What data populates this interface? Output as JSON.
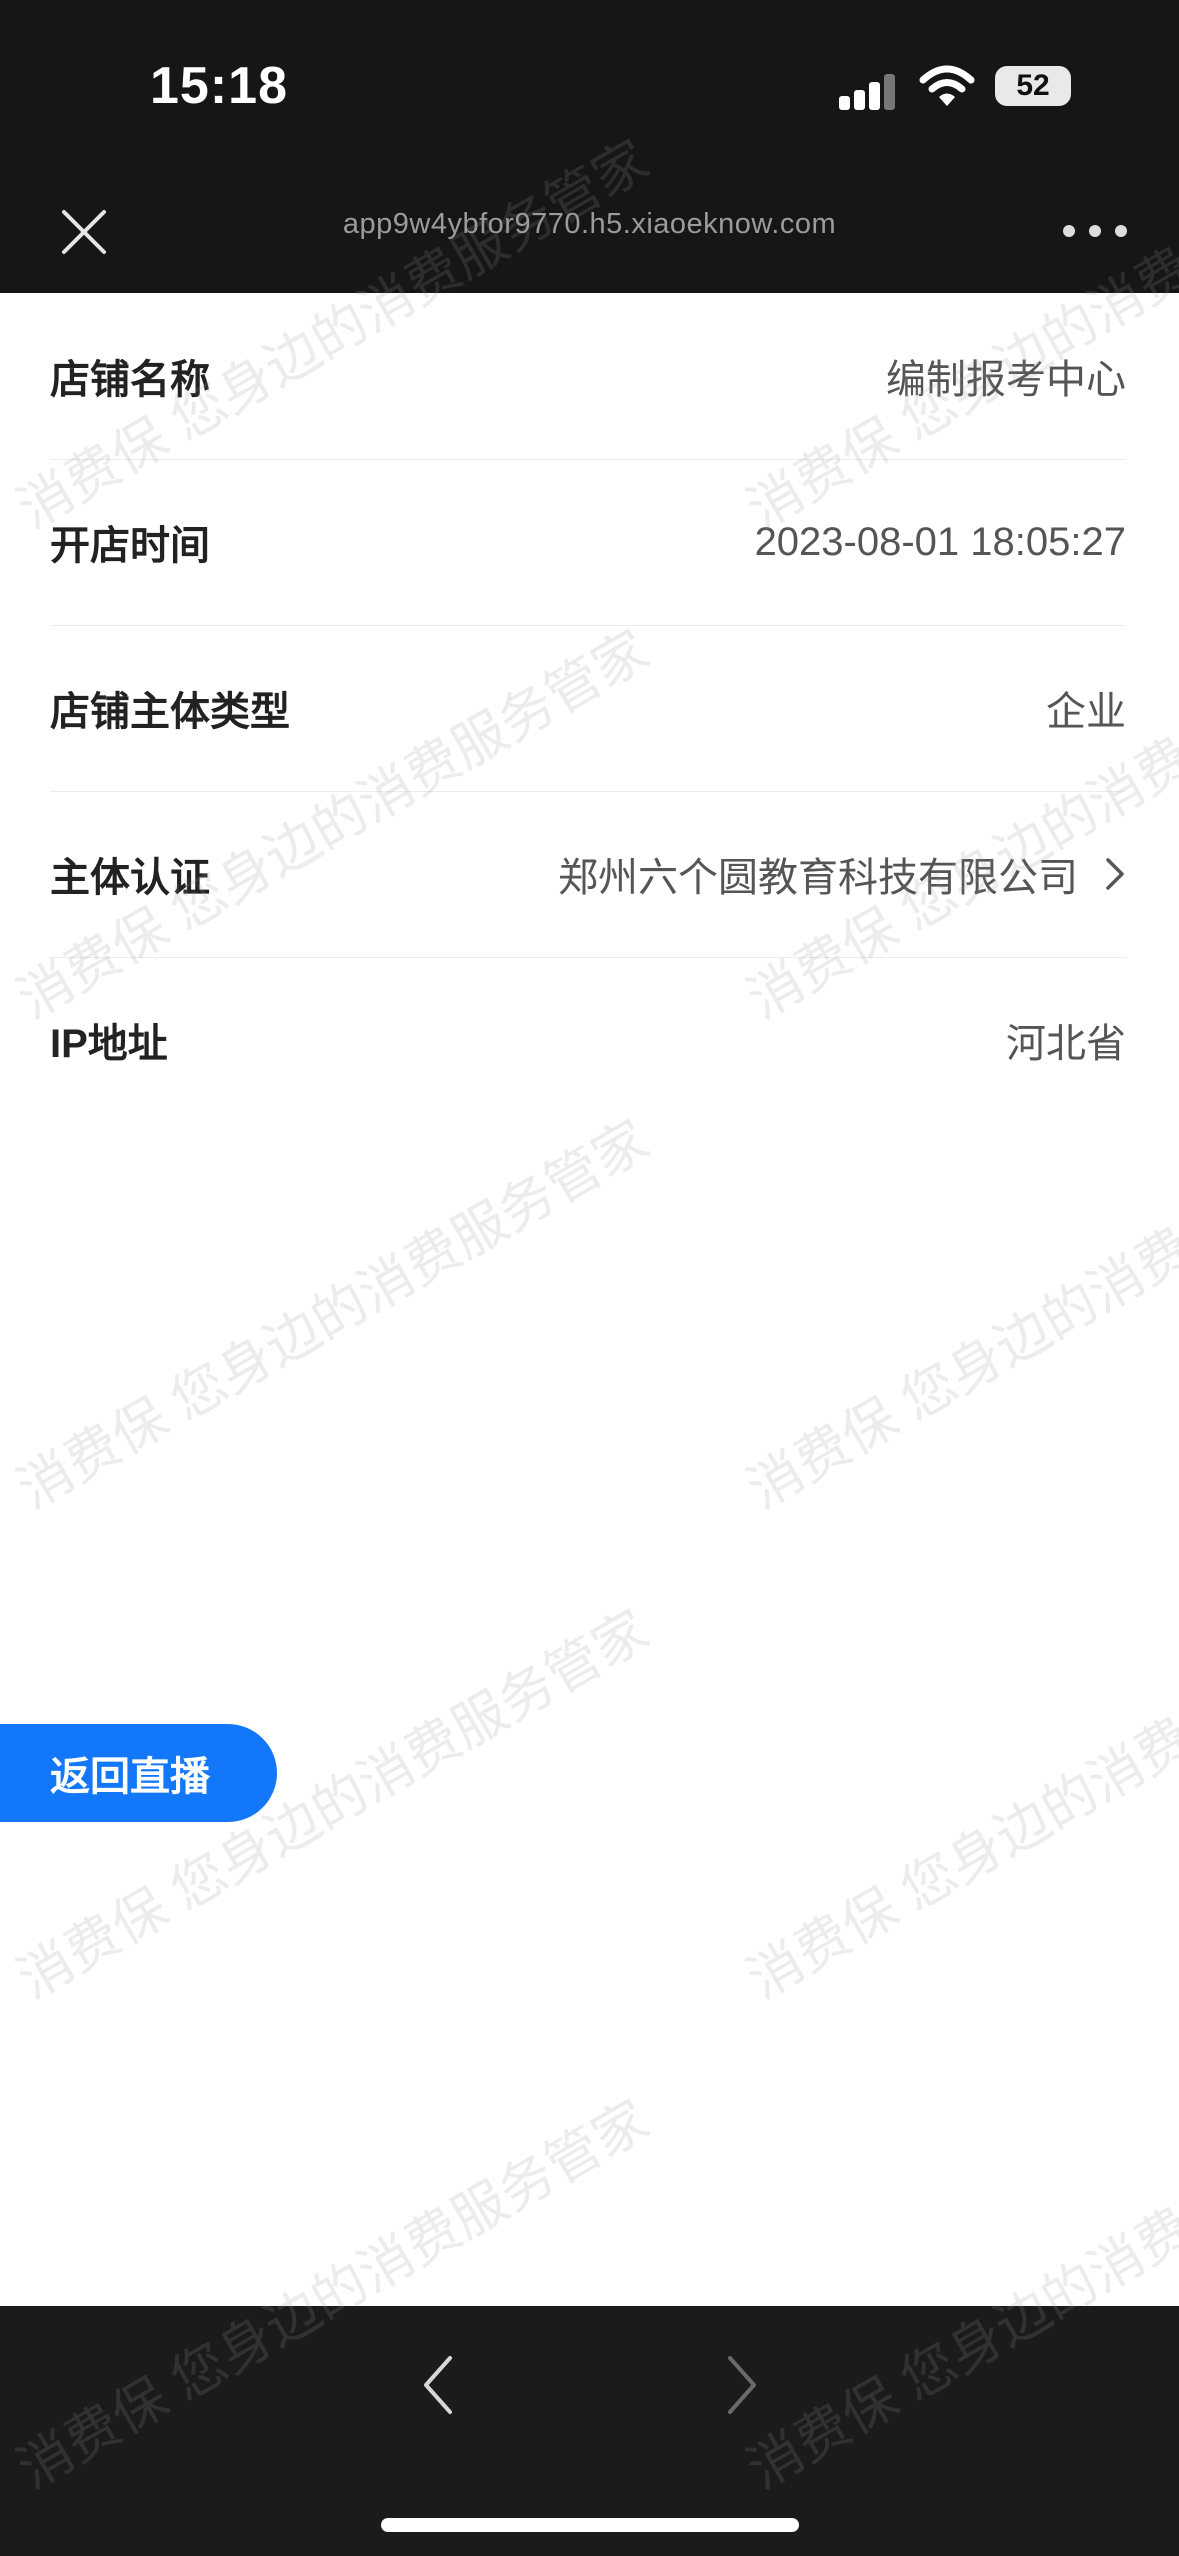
{
  "status_bar": {
    "time": "15:18",
    "battery": "52",
    "icons": [
      "cellular-signal-icon",
      "wifi-icon",
      "battery-icon"
    ]
  },
  "nav_bar": {
    "url": "app9w4ybfor9770.h5.xiaoeknow.com",
    "icons": [
      "close-icon",
      "more-icon"
    ]
  },
  "shop_info": [
    {
      "label": "店铺名称",
      "value": "编制报考中心"
    },
    {
      "label": "开店时间",
      "value": "2023-08-01 18:05:27"
    },
    {
      "label": "店铺主体类型",
      "value": "企业"
    },
    {
      "label": "主体认证",
      "value": "郑州六个圆教育科技有限公司",
      "has_chevron": true
    },
    {
      "label": "IP地址",
      "value": "河北省"
    }
  ],
  "back_live_button": "返回直播",
  "watermark": {
    "line_a": "消费保 您身边的消费服务管家",
    "line_b": "您身边的消费服务管家"
  },
  "bottom_bar": {
    "icons": [
      "back-arrow-icon",
      "forward-arrow-icon"
    ]
  },
  "colors": {
    "accent": "#1377fa",
    "bar_dark": "#161616"
  }
}
